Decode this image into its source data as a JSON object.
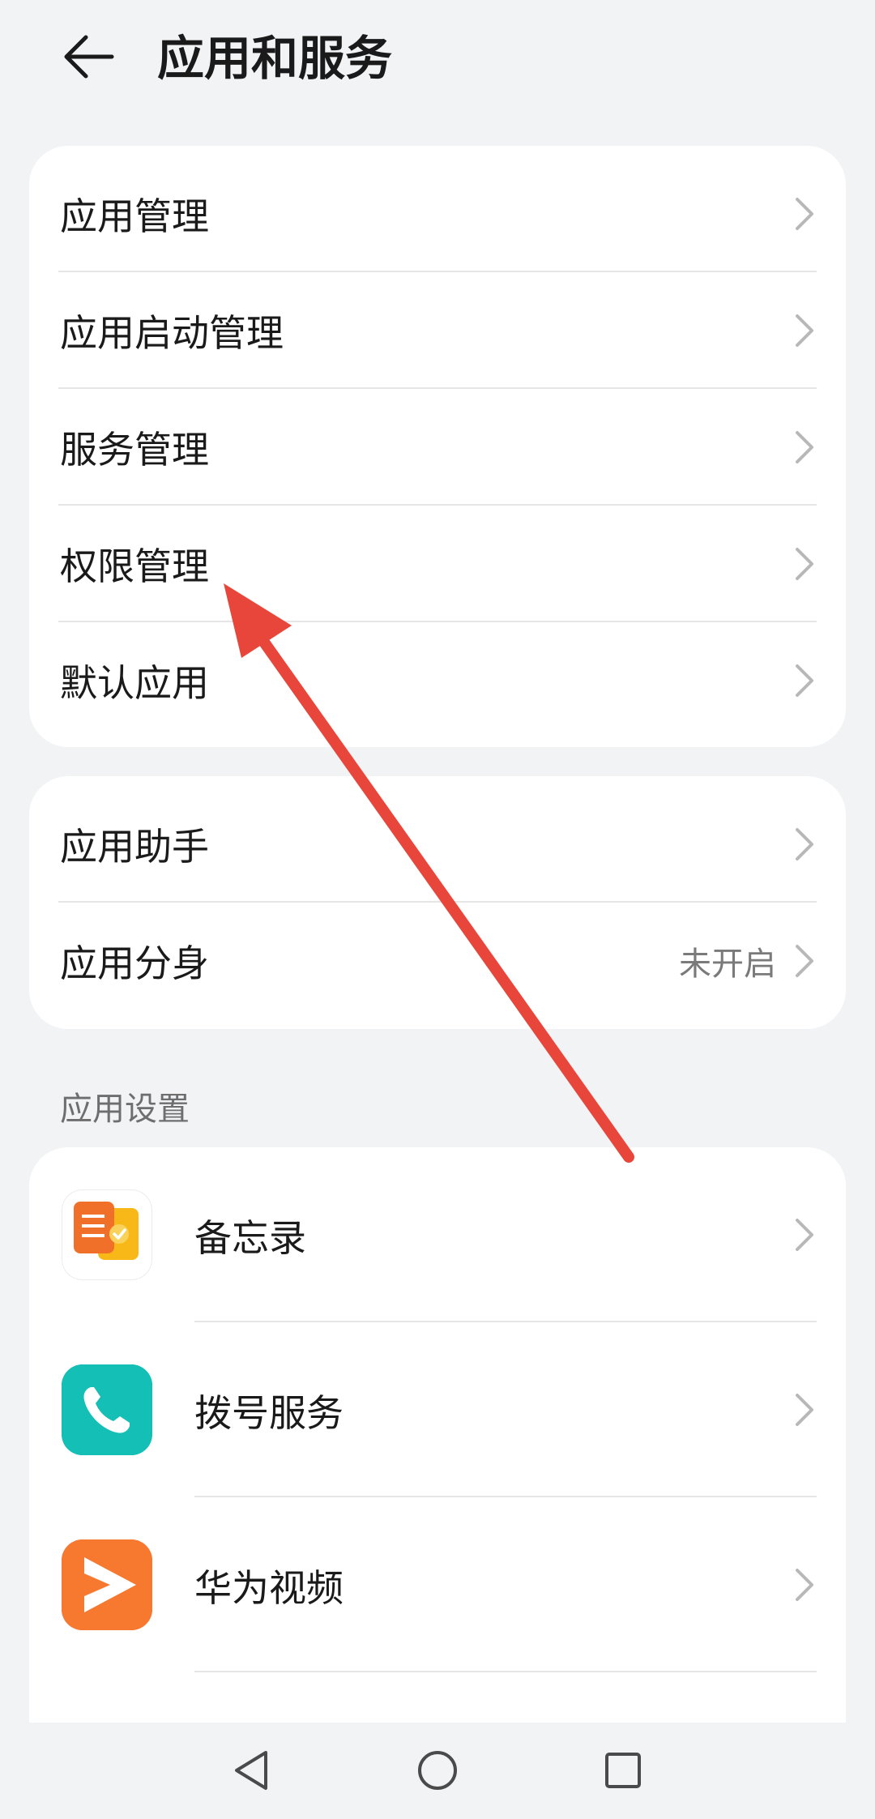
{
  "header": {
    "title": "应用和服务",
    "back_icon": "arrow-left-icon"
  },
  "group1": {
    "items": [
      {
        "label": "应用管理"
      },
      {
        "label": "应用启动管理"
      },
      {
        "label": "服务管理"
      },
      {
        "label": "权限管理"
      },
      {
        "label": "默认应用"
      }
    ]
  },
  "group2": {
    "items": [
      {
        "label": "应用助手",
        "value": ""
      },
      {
        "label": "应用分身",
        "value": "未开启"
      }
    ]
  },
  "app_settings": {
    "header": "应用设置",
    "items": [
      {
        "label": "备忘录",
        "icon": "memo-app-icon"
      },
      {
        "label": "拨号服务",
        "icon": "phone-app-icon"
      },
      {
        "label": "华为视频",
        "icon": "video-app-icon"
      }
    ]
  },
  "nav": {
    "back_icon": "nav-back-icon",
    "home_icon": "nav-home-icon",
    "recents_icon": "nav-recents-icon"
  },
  "colors": {
    "annotation_arrow": "#e8463a",
    "phone_teal": "#14bfb5",
    "video_orange": "#f7782f",
    "memo_orange": "#f0702a",
    "memo_yellow": "#f8b818"
  }
}
